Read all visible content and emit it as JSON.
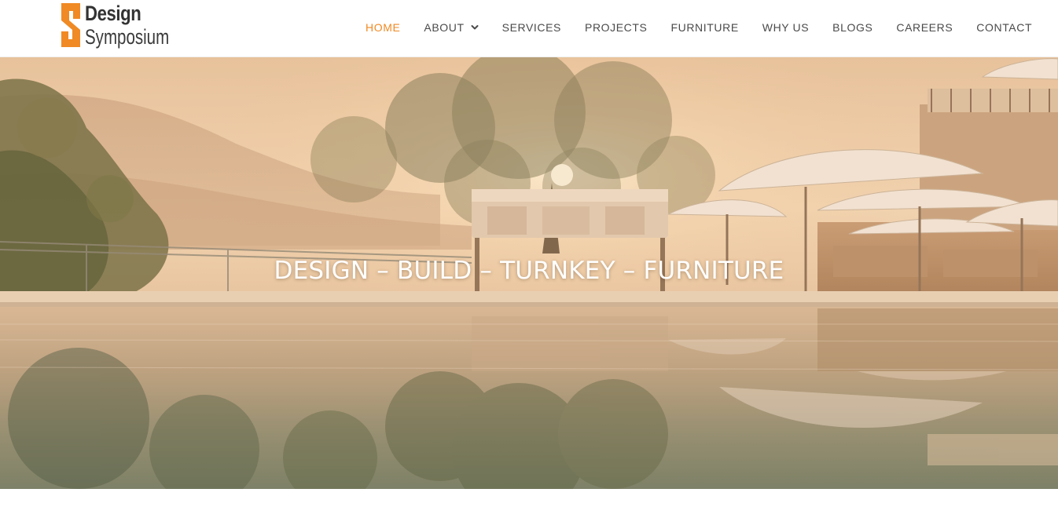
{
  "brand": {
    "name_line1": "Design",
    "name_line2": "Symposium",
    "accent_color": "#f08a24",
    "logo_icon": "letter-s-logo-icon"
  },
  "nav": {
    "items": [
      {
        "label": "HOME",
        "active": true
      },
      {
        "label": "ABOUT",
        "has_dropdown": true
      },
      {
        "label": "SERVICES"
      },
      {
        "label": "PROJECTS"
      },
      {
        "label": "FURNITURE"
      },
      {
        "label": "WHY US"
      },
      {
        "label": "BLOGS"
      },
      {
        "label": "CAREERS"
      },
      {
        "label": "CONTACT"
      }
    ],
    "dropdown_icon": "chevron-down-icon",
    "text_color": "#4a4a4a"
  },
  "hero": {
    "heading": "DESIGN – BUILD – TURNKEY – FURNITURE",
    "image": "sunset-infinity-pool-with-umbrellas-and-trees"
  }
}
